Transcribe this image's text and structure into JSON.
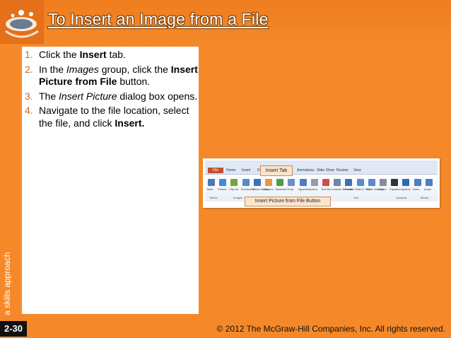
{
  "slide": {
    "title": "To Insert an Image from a File",
    "side_label": "a skills approach",
    "steps": [
      {
        "num": "1.",
        "parts": [
          {
            "t": "Click the ",
            "s": "n"
          },
          {
            "t": "Insert",
            "s": "b"
          },
          {
            "t": " tab.",
            "s": "n"
          }
        ]
      },
      {
        "num": "2.",
        "parts": [
          {
            "t": "In the ",
            "s": "n"
          },
          {
            "t": "Images",
            "s": "i"
          },
          {
            "t": " group, click the ",
            "s": "n"
          },
          {
            "t": "Insert Picture from File",
            "s": "b"
          },
          {
            "t": " button.",
            "s": "n"
          }
        ]
      },
      {
        "num": "3.",
        "parts": [
          {
            "t": "The ",
            "s": "n"
          },
          {
            "t": "Insert Picture",
            "s": "i"
          },
          {
            "t": " dialog box opens.",
            "s": "n"
          }
        ]
      },
      {
        "num": "4.",
        "parts": [
          {
            "t": "Navigate to the file location, select the file, and click ",
            "s": "n"
          },
          {
            "t": "Insert.",
            "s": "b"
          }
        ]
      }
    ],
    "callouts": {
      "insert_tab": "Insert Tab",
      "insert_picture_button": "Insert Picture from File Button"
    },
    "ribbon": {
      "tabs": [
        "File",
        "Home",
        "Insert",
        "Design",
        "Transitions",
        "Animations",
        "Slide Show",
        "Review",
        "View"
      ],
      "buttons": [
        "Table",
        "Picture",
        "Clip Art",
        "Screenshot",
        "Photo Album",
        "Shapes",
        "SmartArt",
        "Chart",
        "Hyperlink",
        "Action",
        "Text Box",
        "Header & Footer",
        "WordArt",
        "Date & Time",
        "Slide Number",
        "Object",
        "Equation",
        "Symbol",
        "Video",
        "Audio"
      ],
      "groups": [
        "Tables",
        "Images",
        "Illustrations",
        "Links",
        "Text",
        "Symbols",
        "Media"
      ]
    },
    "footer": {
      "page_number": "2-30",
      "copyright": "© 2012 The McGraw-Hill Companies, Inc. All rights reserved."
    }
  },
  "colors": {
    "background": "#f5892a",
    "step_number": "#d4651a",
    "footer_page_bg": "#111111"
  },
  "icons": [
    "water-splash-logo-icon"
  ]
}
